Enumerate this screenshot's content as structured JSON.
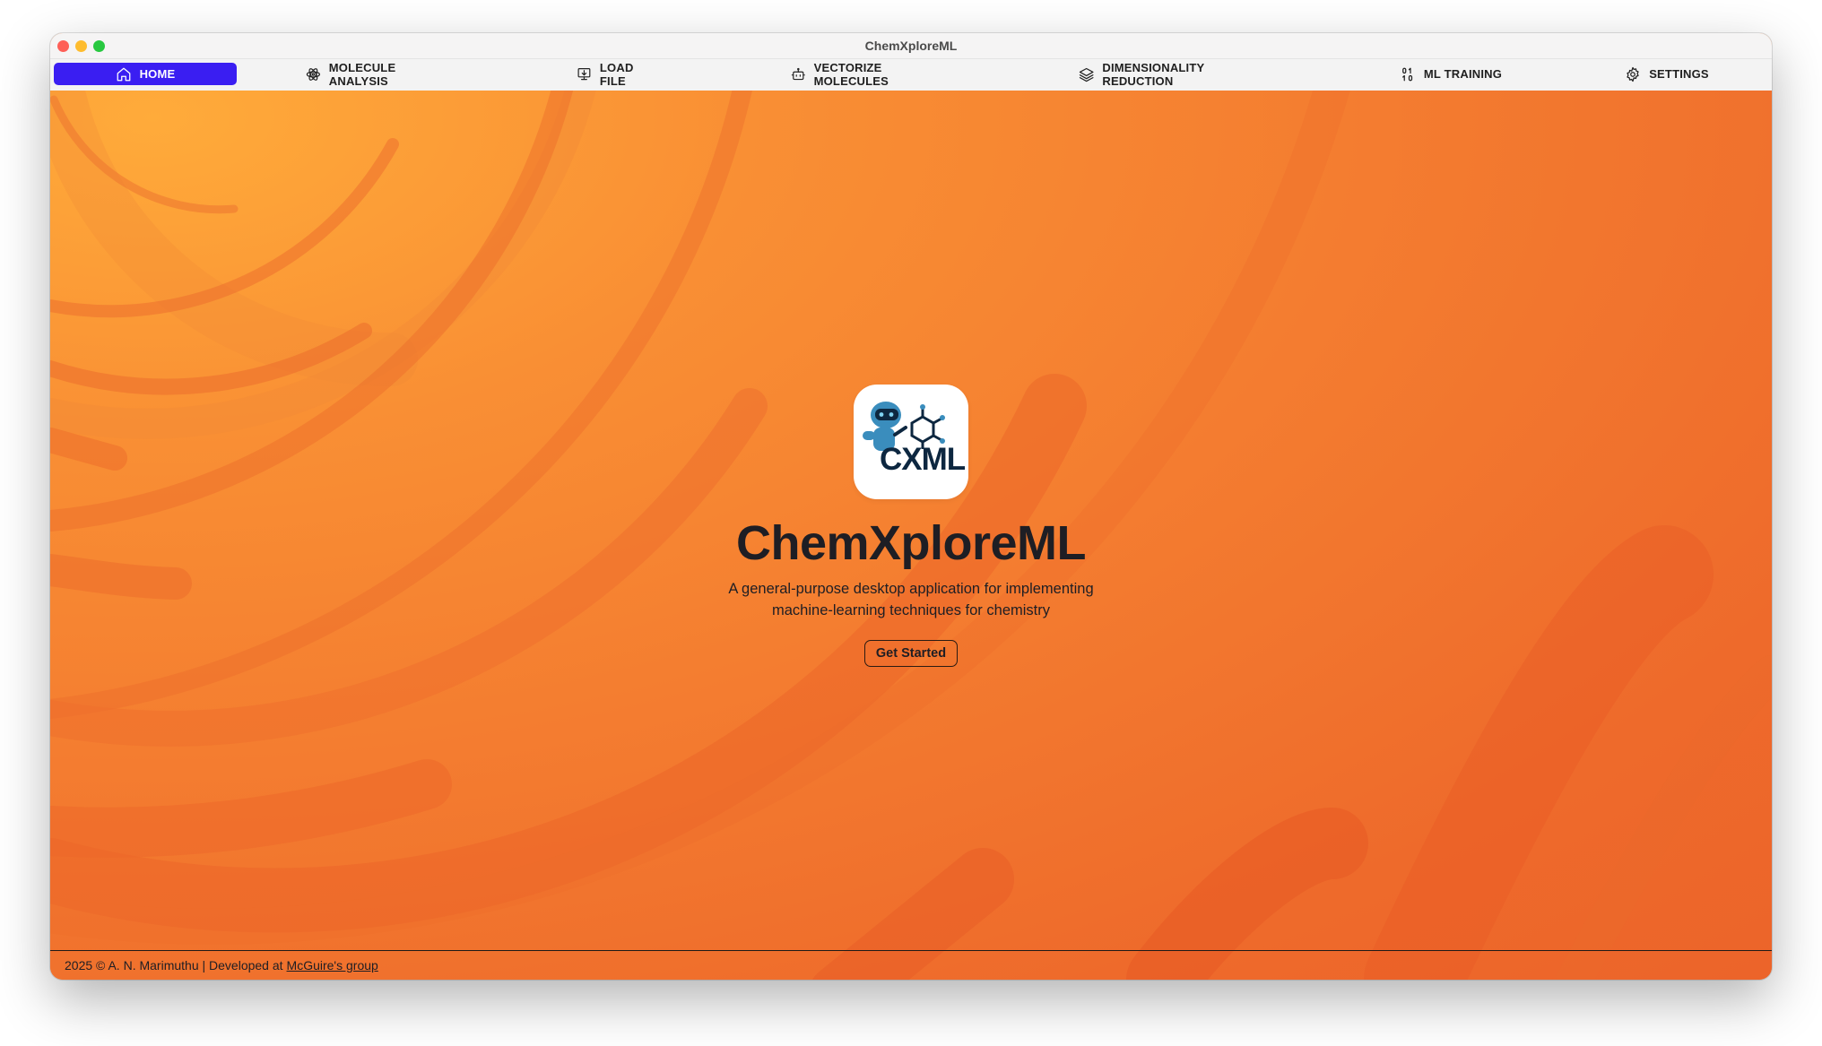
{
  "window": {
    "title": "ChemXploreML"
  },
  "nav": {
    "items": [
      {
        "label": "HOME",
        "icon": "home-icon",
        "active": true
      },
      {
        "label": "MOLECULE ANALYSIS",
        "icon": "atom-icon",
        "active": false
      },
      {
        "label": "LOAD FILE",
        "icon": "monitor-download-icon",
        "active": false
      },
      {
        "label": "VECTORIZE MOLECULES",
        "icon": "robot-icon",
        "active": false
      },
      {
        "label": "DIMENSIONALITY REDUCTION",
        "icon": "layers-icon",
        "active": false
      },
      {
        "label": "ML TRAINING",
        "icon": "binary-icon",
        "active": false
      },
      {
        "label": "SETTINGS",
        "icon": "gear-icon",
        "active": false
      }
    ]
  },
  "hero": {
    "logo_text": "CXML",
    "title": "ChemXploreML",
    "subtitle_line1": "A general-purpose desktop application for implementing",
    "subtitle_line2": "machine-learning techniques for chemistry",
    "cta_label": "Get Started"
  },
  "footer": {
    "text": "2025 © A. N. Marimuthu | Developed at",
    "link_label": "McGuire's group"
  },
  "colors": {
    "accent": "#3a1ef2",
    "background_warm": "#f47d30",
    "text_dark": "#1e1e24"
  }
}
